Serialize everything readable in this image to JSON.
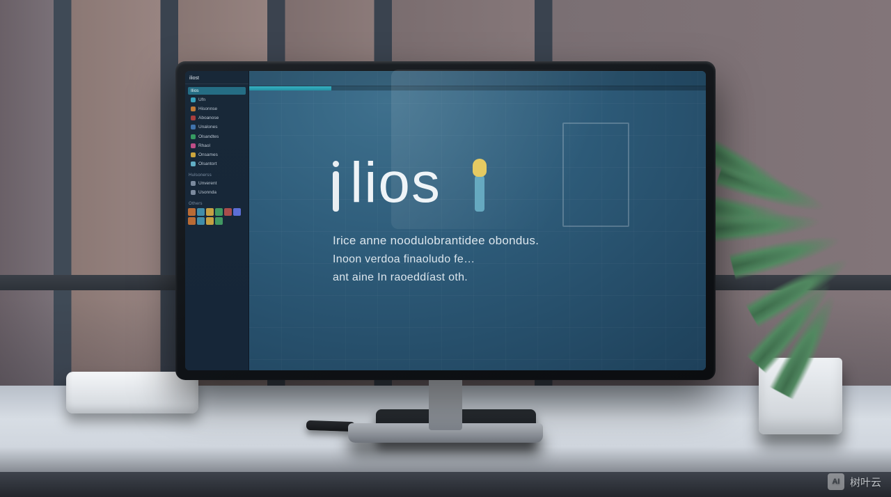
{
  "watermark": {
    "badge": "AI",
    "text": "树叶云"
  },
  "app": {
    "sidebar": {
      "header": "iliost",
      "active_tab": "Ilios",
      "items": [
        {
          "label": "Ufn",
          "color": "#2fa4c2"
        },
        {
          "label": "Hisonnse",
          "color": "#c7782d"
        },
        {
          "label": "Aboanose",
          "color": "#b23b3b"
        },
        {
          "label": "Unalones",
          "color": "#3b74b2"
        },
        {
          "label": "Olsandtes",
          "color": "#2e9e5e"
        },
        {
          "label": "Rhaol",
          "color": "#c74a8a"
        },
        {
          "label": "Onsames",
          "color": "#d0a531"
        },
        {
          "label": "Olsantort",
          "color": "#5ab0c9"
        }
      ],
      "section_a": "Hulsonerss",
      "more": [
        {
          "label": "Unverent",
          "color": "#7a8aa0"
        },
        {
          "label": "Usonnda",
          "color": "#7a8aa0"
        }
      ],
      "section_b": "Others",
      "thumb_colors": [
        "#c06a2e",
        "#3a8fae",
        "#caa038",
        "#3a9a5e",
        "#b24a4a",
        "#5a6ee0",
        "#c06a2e",
        "#3a8fae",
        "#caa038",
        "#3a9a5e"
      ]
    },
    "progress_percent": 18,
    "hero": {
      "logo_text": "lios",
      "line1": "Irice anne noodulobrantidee obondus.",
      "line2": "Inoon verdoa finaoludo fe…",
      "line3": "ant aine In raoeddíast oth."
    }
  }
}
